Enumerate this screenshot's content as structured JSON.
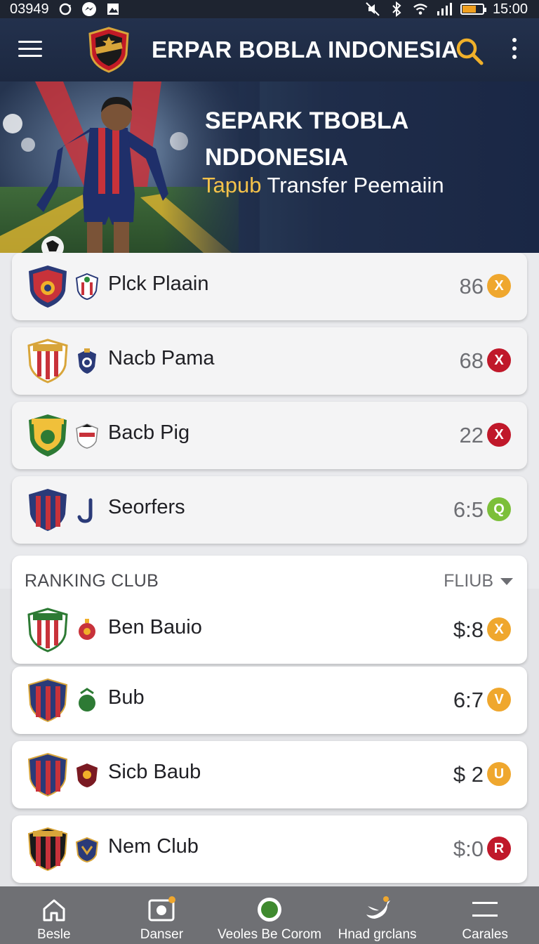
{
  "status_bar": {
    "time_left": "03949",
    "time_right": "15:00",
    "battery_level": 0.7
  },
  "app_bar": {
    "title": "ERPAR BOBLA INDONESIA",
    "icons": [
      "menu-icon",
      "club-logo",
      "search-icon",
      "more-vert-icon"
    ]
  },
  "hero": {
    "title": "SEPARK TBOBLA NDDONESIA",
    "subtitle_accent": "Tapub",
    "subtitle_rest": " Transfer Peemaiin"
  },
  "players": [
    {
      "name": "Plck Plaain",
      "score": "86",
      "badge": "X",
      "badge_color": "#efa72e"
    },
    {
      "name": "Nacb Pama",
      "score": "68",
      "badge": "X",
      "badge_color": "#c0182a"
    },
    {
      "name": "Bacb Pig",
      "score": "22",
      "badge": "X",
      "badge_color": "#c0182a"
    },
    {
      "name": "Seorfers",
      "score": "6:5",
      "badge": "Q",
      "badge_color": "#7cbf3a"
    }
  ],
  "ranking": {
    "title": "RANKING CLUB",
    "filter": "FLIUB",
    "clubs": [
      {
        "name": "Ben Bauio",
        "score": "$:8",
        "badge": "X",
        "badge_color": "#efa72e"
      },
      {
        "name": "Bub",
        "score": "6:7",
        "badge": "V",
        "badge_color": "#efa72e"
      },
      {
        "name": "Sicb Baub",
        "score": "$ 2",
        "badge": "U",
        "badge_color": "#efa72e"
      },
      {
        "name": "Nem Club",
        "score": "$:0",
        "badge": "R",
        "badge_color": "#c0182a"
      }
    ]
  },
  "bottom_nav": [
    {
      "label": "Besle",
      "icon": "home-icon"
    },
    {
      "label": "Danser",
      "icon": "camera-icon"
    },
    {
      "label": "Veoles Be Corom",
      "icon": "record-icon"
    },
    {
      "label": "Hnad grclans",
      "icon": "bird-icon"
    },
    {
      "label": "Carales",
      "icon": "lines-icon"
    }
  ]
}
